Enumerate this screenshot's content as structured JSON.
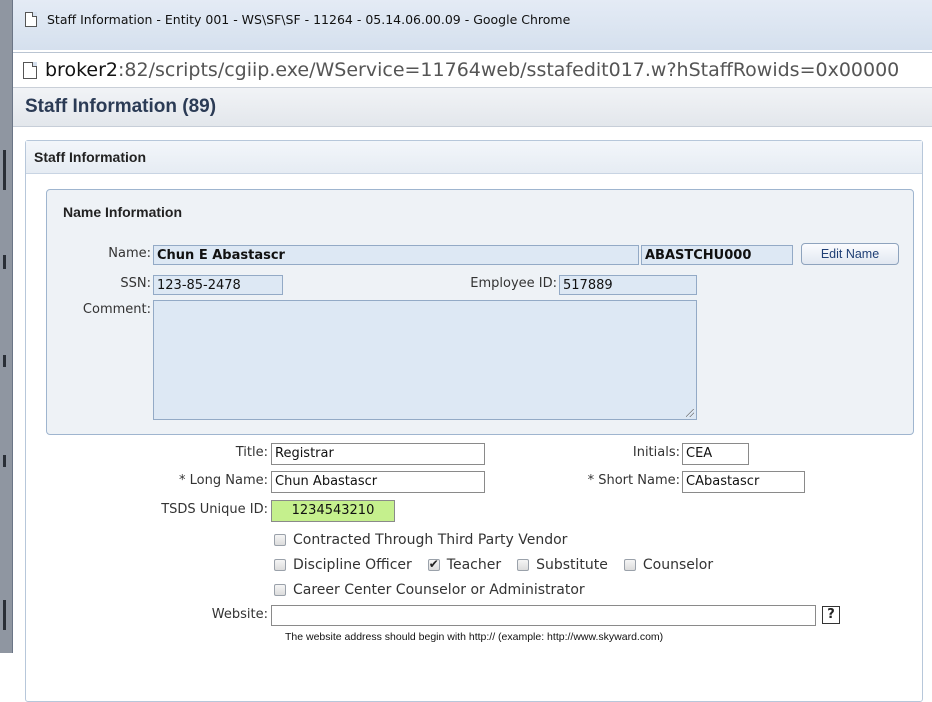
{
  "window": {
    "title": "Staff Information - Entity 001 - WS\\SF\\SF - 11264 - 05.14.06.00.09 - Google Chrome",
    "url_host": "broker2",
    "url_rest": ":82/scripts/cgiip.exe/WService=11764web/sstafedit017.w?hStaffRowids=0x00000"
  },
  "page": {
    "header": "Staff Information (89)",
    "panel_title": "Staff Information"
  },
  "name_info": {
    "title": "Name Information",
    "name_label": "Name:",
    "name_value": "Chun E Abastascr",
    "name_key": "ABASTCHU000",
    "edit_button": "Edit Name",
    "ssn_label": "SSN:",
    "ssn_value": "123-85-2478",
    "employee_id_label": "Employee ID:",
    "employee_id_value": "517889",
    "comment_label": "Comment:"
  },
  "form": {
    "title_label": "Title:",
    "title_value": "Registrar",
    "initials_label": "Initials:",
    "initials_value": "CEA",
    "long_name_label": "* Long Name:",
    "long_name_value": "Chun Abastascr",
    "short_name_label": "* Short Name:",
    "short_name_value": "CAbastascr",
    "tsds_label": "TSDS Unique ID:",
    "tsds_value": "1234543210",
    "checkboxes": {
      "contracted": {
        "label": "Contracted Through Third Party Vendor",
        "checked": false
      },
      "discipline": {
        "label": "Discipline Officer",
        "checked": false
      },
      "teacher": {
        "label": "Teacher",
        "checked": true
      },
      "substitute": {
        "label": "Substitute",
        "checked": false
      },
      "counselor": {
        "label": "Counselor",
        "checked": false
      },
      "career": {
        "label": "Career Center Counselor or Administrator",
        "checked": false
      }
    },
    "website_label": "Website:",
    "website_value": "",
    "help_label": "?",
    "website_hint": "The website address should begin with http://     (example: http://www.skyward.com)"
  },
  "colors": {
    "tsds_highlight": "#c5f08d",
    "readonly_field": "#dde8f4",
    "header_text": "#2b3b55"
  }
}
